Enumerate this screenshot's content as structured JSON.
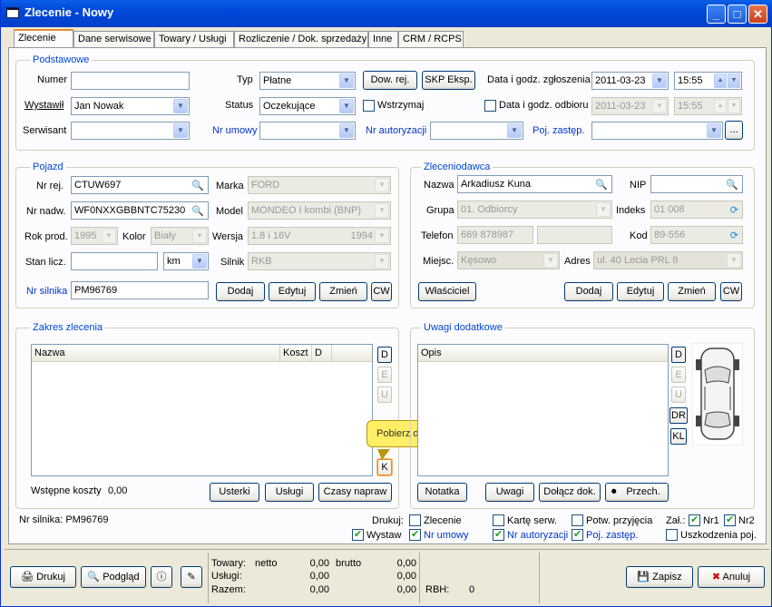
{
  "window": {
    "title": "Zlecenie - Nowy",
    "min": "_",
    "max": "□",
    "close": "✕"
  },
  "tabs": [
    "Zlecenie",
    "Dane serwisowe",
    "Towary / Usługi",
    "Rozliczenie / Dok. sprzedaży",
    "Inne",
    "CRM / RCPS"
  ],
  "podstawowe": {
    "title": "Podstawowe",
    "numer_label": "Numer",
    "numer_value": "",
    "wystawil_label": "Wystawił",
    "wystawil_value": "Jan Nowak",
    "serwisant_label": "Serwisant",
    "serwisant_value": "",
    "typ_label": "Typ",
    "typ_value": "Płatne",
    "status_label": "Status",
    "status_value": "Oczekujące",
    "nr_umowy_label": "Nr umowy",
    "nr_umowy_value": "",
    "dow_rej": "Dow. rej.",
    "skp": "SKP Eksp.",
    "wstrzymaj": "Wstrzymaj",
    "nr_autoryzacji_label": "Nr autoryzacji",
    "nr_autoryzacji_value": "",
    "data_zgl_label": "Data i godz. zgłoszenia",
    "data_zgl_date": "2011-03-23",
    "data_zgl_time": "15:55",
    "data_odb_label": "Data i godz. odbioru",
    "data_odb_date": "2011-03-23",
    "data_odb_time": "15:55",
    "poj_zastep_label": "Poj. zastęp.",
    "poj_zastep_value": "",
    "dots": "..."
  },
  "pojazd": {
    "title": "Pojazd",
    "nr_rej_label": "Nr rej.",
    "nr_rej_value": "CTUW697",
    "nr_nadw_label": "Nr nadw.",
    "nr_nadw_value": "WF0NXXGBBNTC75230",
    "rok_label": "Rok prod.",
    "rok_value": "1995",
    "kolor_label": "Kolor",
    "kolor_value": "Biały",
    "stan_label": "Stan licz.",
    "stan_value": "",
    "stan_unit": "km",
    "marka_label": "Marka",
    "marka_value": "FORD",
    "model_label": "Model",
    "model_value": "MONDEO I kombi (BNP)",
    "wersja_label": "Wersja",
    "wersja_value": "1.8 i 16V",
    "wersja_extra": "1994",
    "silnik_label": "Silnik",
    "silnik_value": "RKB",
    "nr_silnika_label": "Nr silnika",
    "nr_silnika_value": "PM96769",
    "buttons": [
      "Dodaj",
      "Edytuj",
      "Zmień",
      "CW"
    ]
  },
  "zleceniodawca": {
    "title": "Zleceniodawca",
    "nazwa_label": "Nazwa",
    "nazwa_value": "Arkadiusz Kuna",
    "nip_label": "NIP",
    "nip_value": "",
    "grupa_label": "Grupa",
    "grupa_value": "01. Odbiorcy",
    "indeks_label": "Indeks",
    "indeks_value": "01 008",
    "telefon_label": "Telefon",
    "telefon_value": "669 878987",
    "telefon2_value": "",
    "kod_label": "Kod",
    "kod_value": "89-556",
    "miejsc_label": "Miejsc.",
    "miejsc_value": "Kęsowo",
    "adres_label": "Adres",
    "adres_value": "ul. 40 Lecia PRL 8",
    "wlasciciel": "Właściciel",
    "buttons": [
      "Dodaj",
      "Edytuj",
      "Zmień",
      "CW"
    ]
  },
  "zakres": {
    "title": "Zakres zlecenia",
    "cols": [
      "Nazwa",
      "Koszt",
      "D"
    ],
    "side_buttons": [
      "D",
      "E",
      "U"
    ],
    "k_button": "K",
    "tooltip": "Pobierz dane (towary/usługi) z kosztorysu",
    "wstepne_label": "Wstępne koszty",
    "wstepne_value": "0,00",
    "buttons": [
      "Usterki",
      "Usługi",
      "Czasy napraw"
    ]
  },
  "uwagi": {
    "title": "Uwagi dodatkowe",
    "col": "Opis",
    "side_buttons": [
      "D",
      "E",
      "U",
      "DR",
      "KL"
    ],
    "buttons": [
      "Notatka",
      "Uwagi",
      "Dołącz dok.",
      "Przech."
    ]
  },
  "footer_panel": {
    "nr_silnika": "Nr silnika: PM96769",
    "drukuj": "Drukuj:",
    "zlecenie": "Zlecenie",
    "karte": "Kartę serw.",
    "potw": "Potw. przyjęcia",
    "wystaw": "Wystaw",
    "nr_umowy": "Nr umowy",
    "nr_autoryzacji": "Nr autoryzacji",
    "poj_zastep": "Poj. zastęp.",
    "zal": "Zał.:",
    "nr1": "Nr1",
    "nr2": "Nr2",
    "uszkodzenia": "Uszkodzenia poj."
  },
  "bottom": {
    "drukuj": "Drukuj",
    "podglad": "Podgląd",
    "towary": "Towary:",
    "uslugi": "Usługi:",
    "razem": "Razem:",
    "netto": "netto",
    "brutto": "brutto",
    "towary_netto": "0,00",
    "uslugi_netto": "0,00",
    "razem_netto": "0,00",
    "towary_brutto": "0,00",
    "uslugi_brutto": "0,00",
    "razem_brutto": "0,00",
    "rbh_label": "RBH:",
    "rbh_value": "0",
    "zapisz": "Zapisz",
    "anuluj": "Anuluj"
  }
}
